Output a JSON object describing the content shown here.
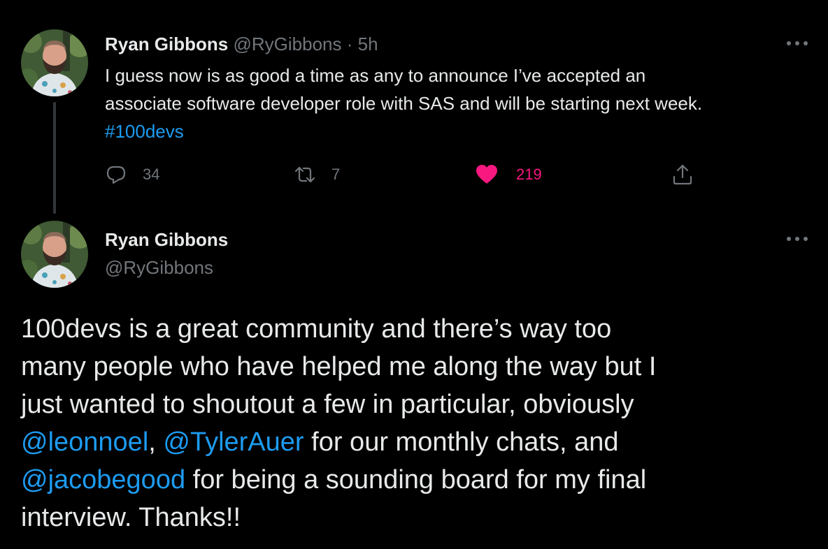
{
  "tweets": [
    {
      "author_name": "Ryan Gibbons",
      "handle": "@RyGibbons",
      "separator": "·",
      "time": "5h",
      "text_line1": "I guess now is as good a time as any to announce I’ve accepted an",
      "text_line2": "associate software developer role with SAS and will be starting next week.",
      "hashtag": "#100devs",
      "replies": "34",
      "retweets": "7",
      "likes": "219",
      "liked": true
    },
    {
      "author_name": "Ryan Gibbons",
      "handle": "@RyGibbons",
      "body": {
        "line1": "100devs is a great community and there’s way too",
        "line2": "many people who have helped me along the way but I",
        "line3": "just wanted to shoutout a few in particular, obviously",
        "mention1": "@leonnoel",
        "sep1": ", ",
        "mention2": "@TylerAuer",
        "line4_tail": " for our monthly chats, and",
        "mention3": "@jacobegood",
        "line5_tail": " for being a sounding board for my final",
        "line6": "interview. Thanks!!"
      }
    }
  ],
  "icons": {
    "reply": "reply-icon",
    "retweet": "retweet-icon",
    "like": "heart-icon",
    "share": "share-icon",
    "more": "more-icon"
  },
  "colors": {
    "background": "#000000",
    "text": "#e7e9ea",
    "secondary": "#71767b",
    "link": "#1d9bf0",
    "like": "#f91880",
    "thread_line": "#333639"
  }
}
